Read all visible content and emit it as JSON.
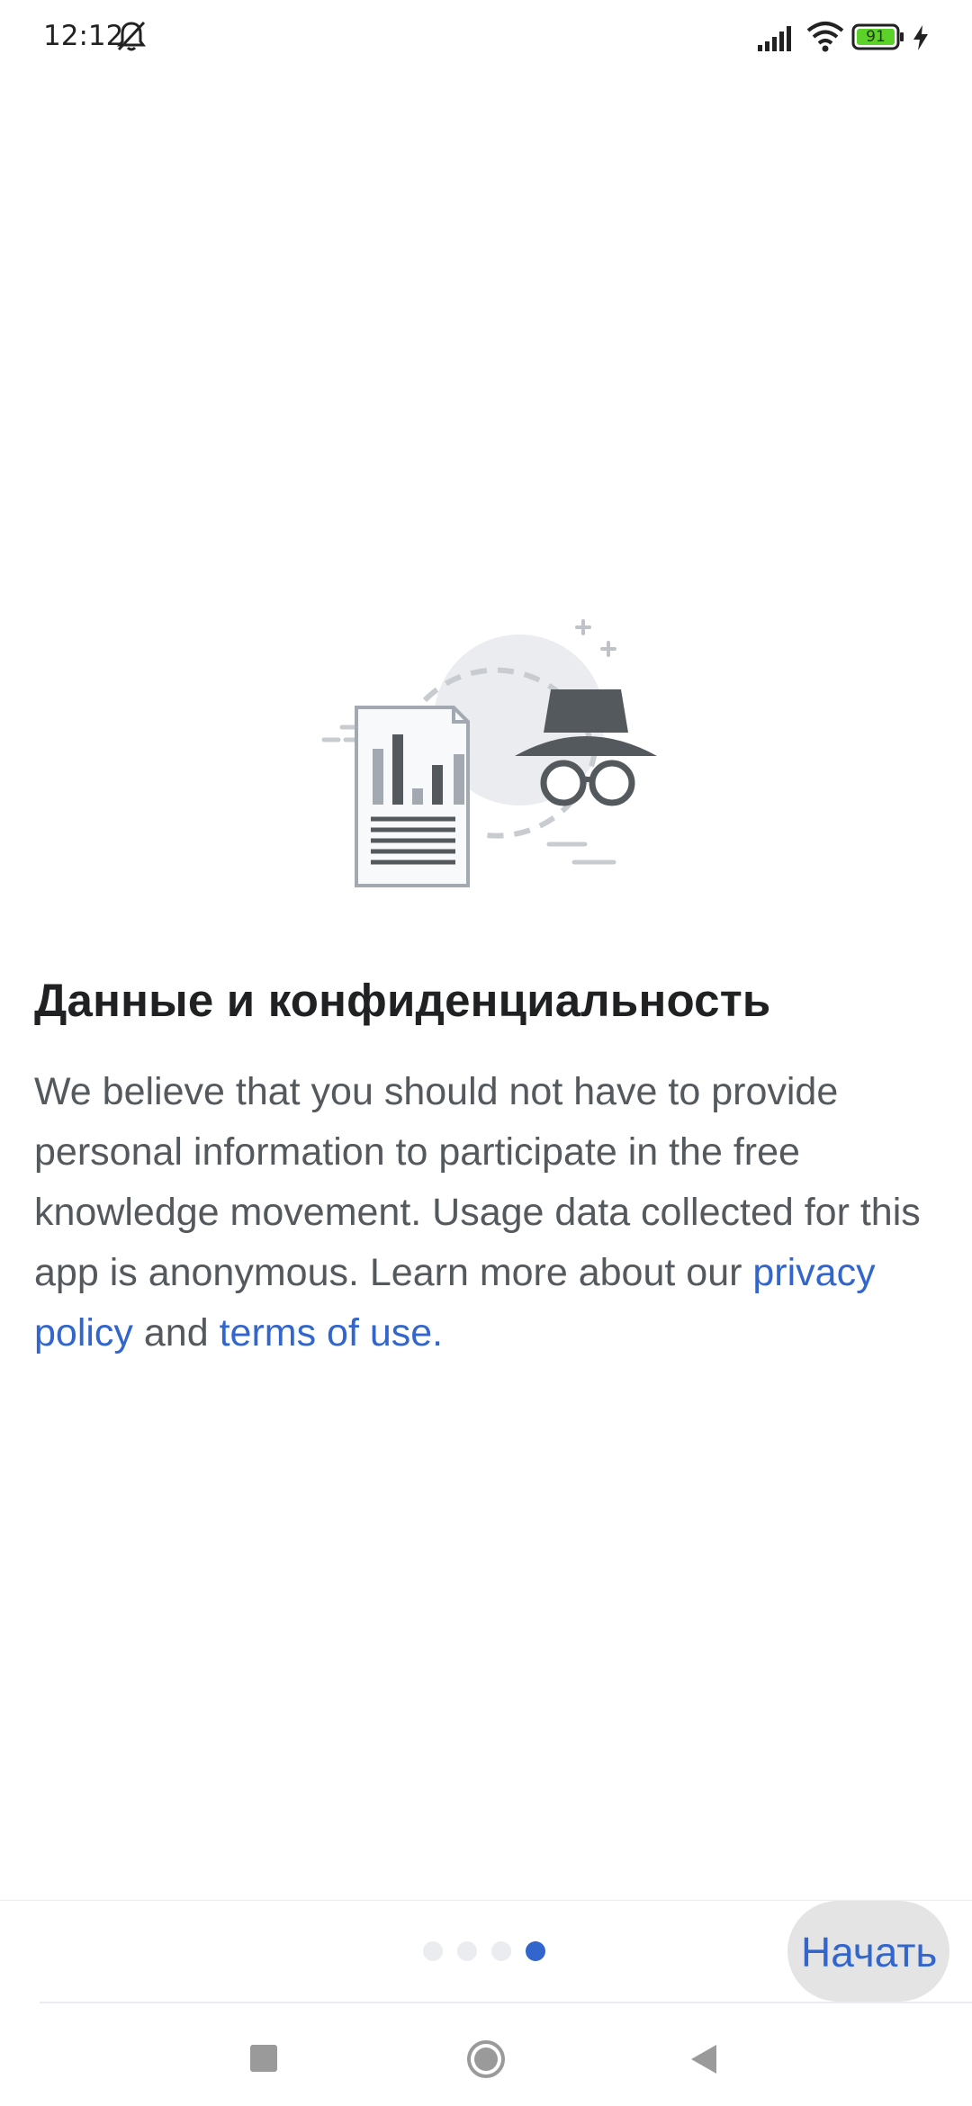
{
  "status_bar": {
    "time": "12:12",
    "battery_level": "91",
    "icons": [
      "bell-off-icon",
      "signal-icon",
      "wifi-icon",
      "battery-icon",
      "charging-icon"
    ],
    "battery_color": "#5bd12a"
  },
  "onboarding": {
    "illustration": "privacy-incognito-data-illustration",
    "title": "Данные и конфиденциальность",
    "body_intro": "We believe that you should not have to provide personal information to participate in the free knowledge movement. Usage data collected for this app is anonymous. Learn more about our ",
    "privacy_link": "privacy policy",
    "and_text": " and ",
    "terms_link": "terms of use",
    "end_text": ".",
    "page_count": 4,
    "current_page": 4
  },
  "footer": {
    "start_label": "Начать"
  },
  "colors": {
    "accent": "#3366cc",
    "title": "#202122",
    "body": "#54595d",
    "dot_inactive": "#eaecf0"
  },
  "nav_bar": {
    "icons": [
      "recents-icon",
      "home-icon",
      "back-icon"
    ]
  }
}
